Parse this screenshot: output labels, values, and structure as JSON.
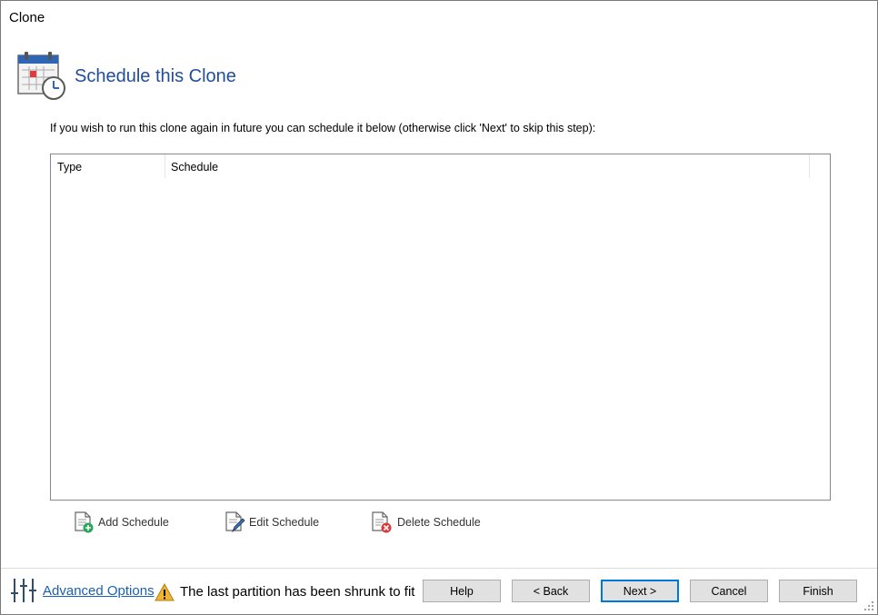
{
  "window": {
    "title": "Clone"
  },
  "header": {
    "title": "Schedule this Clone",
    "icon": "calendar-clock-icon"
  },
  "instruction": "If you wish to run this clone again in future you can schedule it below (otherwise click 'Next' to skip this step):",
  "schedule_list": {
    "columns": [
      "Type",
      "Schedule"
    ],
    "rows": []
  },
  "actions": {
    "add": "Add Schedule",
    "edit": "Edit Schedule",
    "delete": "Delete Schedule"
  },
  "footer": {
    "advanced_options": "Advanced Options",
    "warning": "The last partition has been shrunk to fit",
    "buttons": {
      "help": "Help",
      "back": "< Back",
      "next": "Next >",
      "cancel": "Cancel",
      "finish": "Finish"
    }
  },
  "colors": {
    "accent": "#1f4e9c",
    "link": "#1a5fb4",
    "default_button_border": "#0078d7"
  }
}
